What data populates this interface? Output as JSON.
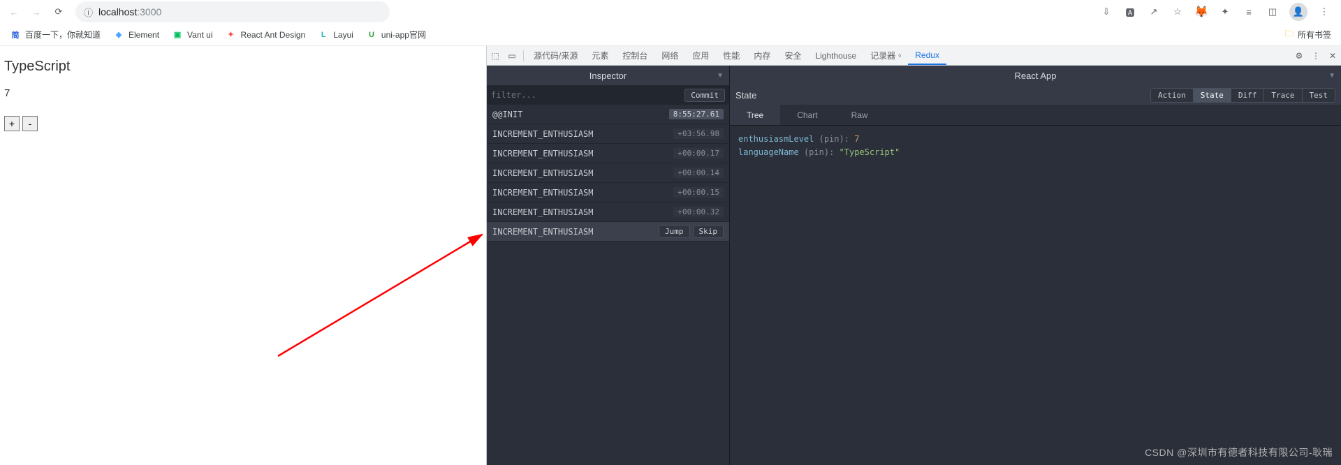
{
  "browser": {
    "url_host": "localhost",
    "url_port": ":3000",
    "bookmarks_folder": "所有书签",
    "bookmarks": [
      {
        "label": "百度一下，你就知道",
        "color": "#2c5fdb",
        "glyph": "简"
      },
      {
        "label": "Element",
        "color": "#409eff",
        "glyph": "◈"
      },
      {
        "label": "Vant ui",
        "color": "#07c160",
        "glyph": "▣"
      },
      {
        "label": "React Ant Design",
        "color": "#f74c4c",
        "glyph": "✦"
      },
      {
        "label": "Layui",
        "color": "#16baaa",
        "glyph": "L"
      },
      {
        "label": "uni-app官网",
        "color": "#2b9939",
        "glyph": "U"
      }
    ]
  },
  "page": {
    "heading": "TypeScript",
    "count": "7",
    "plus": "+",
    "minus": "-"
  },
  "devtools": {
    "tabs": [
      "源代码/来源",
      "元素",
      "控制台",
      "网络",
      "应用",
      "性能",
      "内存",
      "安全",
      "Lighthouse",
      "记录器",
      "Redux"
    ],
    "active_tab": "Redux"
  },
  "redux": {
    "inspector_title": "Inspector",
    "filter_placeholder": "filter...",
    "commit_label": "Commit",
    "jump_label": "Jump",
    "skip_label": "Skip",
    "actions": [
      {
        "name": "@@INIT",
        "time": "8:55:27.61",
        "first": true
      },
      {
        "name": "INCREMENT_ENTHUSIASM",
        "time": "+03:56.98"
      },
      {
        "name": "INCREMENT_ENTHUSIASM",
        "time": "+00:00.17"
      },
      {
        "name": "INCREMENT_ENTHUSIASM",
        "time": "+00:00.14"
      },
      {
        "name": "INCREMENT_ENTHUSIASM",
        "time": "+00:00.15"
      },
      {
        "name": "INCREMENT_ENTHUSIASM",
        "time": "+00:00.32"
      },
      {
        "name": "INCREMENT_ENTHUSIASM",
        "time": "",
        "selected": true
      }
    ],
    "state_panel_title": "React App",
    "state_label": "State",
    "seg_buttons": [
      "Action",
      "State",
      "Diff",
      "Trace",
      "Test"
    ],
    "seg_active": "State",
    "view_tabs": [
      "Tree",
      "Chart",
      "Raw"
    ],
    "view_active": "Tree",
    "tree": [
      {
        "key": "enthusiasmLevel",
        "pin": "(pin)",
        "value": "7",
        "type": "num"
      },
      {
        "key": "languageName",
        "pin": "(pin)",
        "value": "\"TypeScript\"",
        "type": "str"
      }
    ]
  },
  "watermark": "CSDN @深圳市有德者科技有限公司-耿瑞"
}
